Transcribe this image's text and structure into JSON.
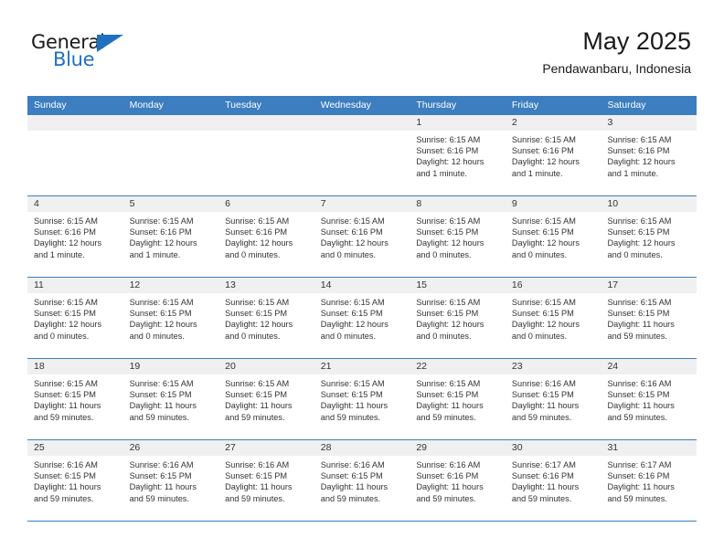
{
  "brand": {
    "name_top": "General",
    "name_bottom": "Blue",
    "accent_color": "#1f70c1"
  },
  "header": {
    "title": "May 2025",
    "subtitle": "Pendawanbaru, Indonesia"
  },
  "calendar": {
    "header_bg": "#3c7ebf",
    "day_names": [
      "Sunday",
      "Monday",
      "Tuesday",
      "Wednesday",
      "Thursday",
      "Friday",
      "Saturday"
    ],
    "labels": {
      "sunrise": "Sunrise:",
      "sunset": "Sunset:",
      "daylight": "Daylight:"
    },
    "weeks": [
      [
        {
          "day": "",
          "empty": true
        },
        {
          "day": "",
          "empty": true
        },
        {
          "day": "",
          "empty": true
        },
        {
          "day": "",
          "empty": true
        },
        {
          "day": "1",
          "sunrise": "Sunrise: 6:15 AM",
          "sunset": "Sunset: 6:16 PM",
          "daylight": "Daylight: 12 hours and 1 minute."
        },
        {
          "day": "2",
          "sunrise": "Sunrise: 6:15 AM",
          "sunset": "Sunset: 6:16 PM",
          "daylight": "Daylight: 12 hours and 1 minute."
        },
        {
          "day": "3",
          "sunrise": "Sunrise: 6:15 AM",
          "sunset": "Sunset: 6:16 PM",
          "daylight": "Daylight: 12 hours and 1 minute."
        }
      ],
      [
        {
          "day": "4",
          "sunrise": "Sunrise: 6:15 AM",
          "sunset": "Sunset: 6:16 PM",
          "daylight": "Daylight: 12 hours and 1 minute."
        },
        {
          "day": "5",
          "sunrise": "Sunrise: 6:15 AM",
          "sunset": "Sunset: 6:16 PM",
          "daylight": "Daylight: 12 hours and 1 minute."
        },
        {
          "day": "6",
          "sunrise": "Sunrise: 6:15 AM",
          "sunset": "Sunset: 6:16 PM",
          "daylight": "Daylight: 12 hours and 0 minutes."
        },
        {
          "day": "7",
          "sunrise": "Sunrise: 6:15 AM",
          "sunset": "Sunset: 6:16 PM",
          "daylight": "Daylight: 12 hours and 0 minutes."
        },
        {
          "day": "8",
          "sunrise": "Sunrise: 6:15 AM",
          "sunset": "Sunset: 6:15 PM",
          "daylight": "Daylight: 12 hours and 0 minutes."
        },
        {
          "day": "9",
          "sunrise": "Sunrise: 6:15 AM",
          "sunset": "Sunset: 6:15 PM",
          "daylight": "Daylight: 12 hours and 0 minutes."
        },
        {
          "day": "10",
          "sunrise": "Sunrise: 6:15 AM",
          "sunset": "Sunset: 6:15 PM",
          "daylight": "Daylight: 12 hours and 0 minutes."
        }
      ],
      [
        {
          "day": "11",
          "sunrise": "Sunrise: 6:15 AM",
          "sunset": "Sunset: 6:15 PM",
          "daylight": "Daylight: 12 hours and 0 minutes."
        },
        {
          "day": "12",
          "sunrise": "Sunrise: 6:15 AM",
          "sunset": "Sunset: 6:15 PM",
          "daylight": "Daylight: 12 hours and 0 minutes."
        },
        {
          "day": "13",
          "sunrise": "Sunrise: 6:15 AM",
          "sunset": "Sunset: 6:15 PM",
          "daylight": "Daylight: 12 hours and 0 minutes."
        },
        {
          "day": "14",
          "sunrise": "Sunrise: 6:15 AM",
          "sunset": "Sunset: 6:15 PM",
          "daylight": "Daylight: 12 hours and 0 minutes."
        },
        {
          "day": "15",
          "sunrise": "Sunrise: 6:15 AM",
          "sunset": "Sunset: 6:15 PM",
          "daylight": "Daylight: 12 hours and 0 minutes."
        },
        {
          "day": "16",
          "sunrise": "Sunrise: 6:15 AM",
          "sunset": "Sunset: 6:15 PM",
          "daylight": "Daylight: 12 hours and 0 minutes."
        },
        {
          "day": "17",
          "sunrise": "Sunrise: 6:15 AM",
          "sunset": "Sunset: 6:15 PM",
          "daylight": "Daylight: 11 hours and 59 minutes."
        }
      ],
      [
        {
          "day": "18",
          "sunrise": "Sunrise: 6:15 AM",
          "sunset": "Sunset: 6:15 PM",
          "daylight": "Daylight: 11 hours and 59 minutes."
        },
        {
          "day": "19",
          "sunrise": "Sunrise: 6:15 AM",
          "sunset": "Sunset: 6:15 PM",
          "daylight": "Daylight: 11 hours and 59 minutes."
        },
        {
          "day": "20",
          "sunrise": "Sunrise: 6:15 AM",
          "sunset": "Sunset: 6:15 PM",
          "daylight": "Daylight: 11 hours and 59 minutes."
        },
        {
          "day": "21",
          "sunrise": "Sunrise: 6:15 AM",
          "sunset": "Sunset: 6:15 PM",
          "daylight": "Daylight: 11 hours and 59 minutes."
        },
        {
          "day": "22",
          "sunrise": "Sunrise: 6:15 AM",
          "sunset": "Sunset: 6:15 PM",
          "daylight": "Daylight: 11 hours and 59 minutes."
        },
        {
          "day": "23",
          "sunrise": "Sunrise: 6:16 AM",
          "sunset": "Sunset: 6:15 PM",
          "daylight": "Daylight: 11 hours and 59 minutes."
        },
        {
          "day": "24",
          "sunrise": "Sunrise: 6:16 AM",
          "sunset": "Sunset: 6:15 PM",
          "daylight": "Daylight: 11 hours and 59 minutes."
        }
      ],
      [
        {
          "day": "25",
          "sunrise": "Sunrise: 6:16 AM",
          "sunset": "Sunset: 6:15 PM",
          "daylight": "Daylight: 11 hours and 59 minutes."
        },
        {
          "day": "26",
          "sunrise": "Sunrise: 6:16 AM",
          "sunset": "Sunset: 6:15 PM",
          "daylight": "Daylight: 11 hours and 59 minutes."
        },
        {
          "day": "27",
          "sunrise": "Sunrise: 6:16 AM",
          "sunset": "Sunset: 6:15 PM",
          "daylight": "Daylight: 11 hours and 59 minutes."
        },
        {
          "day": "28",
          "sunrise": "Sunrise: 6:16 AM",
          "sunset": "Sunset: 6:15 PM",
          "daylight": "Daylight: 11 hours and 59 minutes."
        },
        {
          "day": "29",
          "sunrise": "Sunrise: 6:16 AM",
          "sunset": "Sunset: 6:16 PM",
          "daylight": "Daylight: 11 hours and 59 minutes."
        },
        {
          "day": "30",
          "sunrise": "Sunrise: 6:17 AM",
          "sunset": "Sunset: 6:16 PM",
          "daylight": "Daylight: 11 hours and 59 minutes."
        },
        {
          "day": "31",
          "sunrise": "Sunrise: 6:17 AM",
          "sunset": "Sunset: 6:16 PM",
          "daylight": "Daylight: 11 hours and 59 minutes."
        }
      ]
    ]
  }
}
